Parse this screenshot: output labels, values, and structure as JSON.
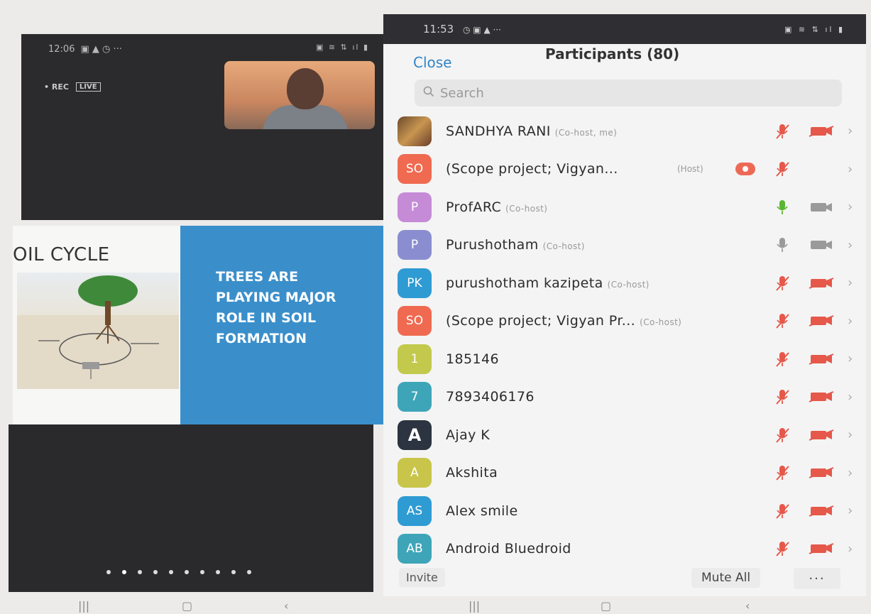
{
  "left": {
    "status_time": "12:06",
    "status_icons": "▣ ▲ ◷ ···",
    "status_right": "▣ ≋ ⇅ ıl ▮",
    "rec_label": "• REC",
    "live_label": "LIVE",
    "slide_title": "OIL CYCLE",
    "slide_lines": [
      "TREES ARE",
      "PLAYING MAJOR",
      "ROLE IN SOIL",
      "FORMATION"
    ],
    "page_count": 10,
    "active_page": 1
  },
  "right": {
    "status_time": "11:53",
    "status_icons": "◷ ▣ ▲ ···",
    "status_right": "▣ ≋ ⇅ ıl ▮",
    "close_label": "Close",
    "title": "Participants (80)",
    "search_placeholder": "Search",
    "invite_label": "Invite",
    "mute_all_label": "Mute All",
    "more_label": "···"
  },
  "colors": {
    "muted": "#e5584a",
    "active_mic": "#5bb534",
    "inactive": "#9a9a9a",
    "accent": "#2f86c8"
  },
  "participants": [
    {
      "initials": "",
      "avatar_type": "photo",
      "avatar_color": "#8b5a2b",
      "name": "SANDHYA RANI",
      "role": "(Co-host, me)",
      "mic": "muted",
      "cam": "off",
      "rec": false
    },
    {
      "initials": "SO",
      "avatar_type": "letter",
      "avatar_color": "#ef6a50",
      "name": "(Scope project; Vigyan...",
      "role": "",
      "host_tag": "(Host)",
      "mic": "muted",
      "cam": "none",
      "rec": true
    },
    {
      "initials": "P",
      "avatar_type": "letter",
      "avatar_color": "#c58bd6",
      "name": "ProfARC",
      "role": "(Co-host)",
      "mic": "on",
      "cam": "inactive",
      "rec": false
    },
    {
      "initials": "P",
      "avatar_type": "letter",
      "avatar_color": "#8a8ed0",
      "name": "Purushotham",
      "role": "(Co-host)",
      "mic": "inactive",
      "cam": "inactive",
      "rec": false
    },
    {
      "initials": "PK",
      "avatar_type": "letter",
      "avatar_color": "#2f9bd3",
      "name": "purushotham kazipeta",
      "role": "(Co-host)",
      "mic": "muted",
      "cam": "off",
      "rec": false
    },
    {
      "initials": "SO",
      "avatar_type": "letter",
      "avatar_color": "#ef6a50",
      "name": "(Scope project; Vigyan Pr...",
      "role": "(Co-host)",
      "mic": "muted",
      "cam": "off",
      "rec": false
    },
    {
      "initials": "1",
      "avatar_type": "letter",
      "avatar_color": "#c3c94c",
      "name": "185146",
      "role": "",
      "mic": "muted",
      "cam": "off",
      "rec": false
    },
    {
      "initials": "7",
      "avatar_type": "letter",
      "avatar_color": "#3ea5b8",
      "name": "7893406176",
      "role": "",
      "mic": "muted",
      "cam": "off",
      "rec": false
    },
    {
      "initials": "A",
      "avatar_type": "logo",
      "avatar_color": "#2b3440",
      "name": "Ajay K",
      "role": "",
      "mic": "muted",
      "cam": "off",
      "rec": false
    },
    {
      "initials": "A",
      "avatar_type": "letter",
      "avatar_color": "#c8c54a",
      "name": "Akshita",
      "role": "",
      "mic": "muted",
      "cam": "off",
      "rec": false
    },
    {
      "initials": "AS",
      "avatar_type": "letter",
      "avatar_color": "#2f9bd3",
      "name": "Alex smile",
      "role": "",
      "mic": "muted",
      "cam": "off",
      "rec": false
    },
    {
      "initials": "AB",
      "avatar_type": "letter",
      "avatar_color": "#3ea5b8",
      "name": "Android Bluedroid",
      "role": "",
      "mic": "muted",
      "cam": "off",
      "rec": false
    }
  ]
}
